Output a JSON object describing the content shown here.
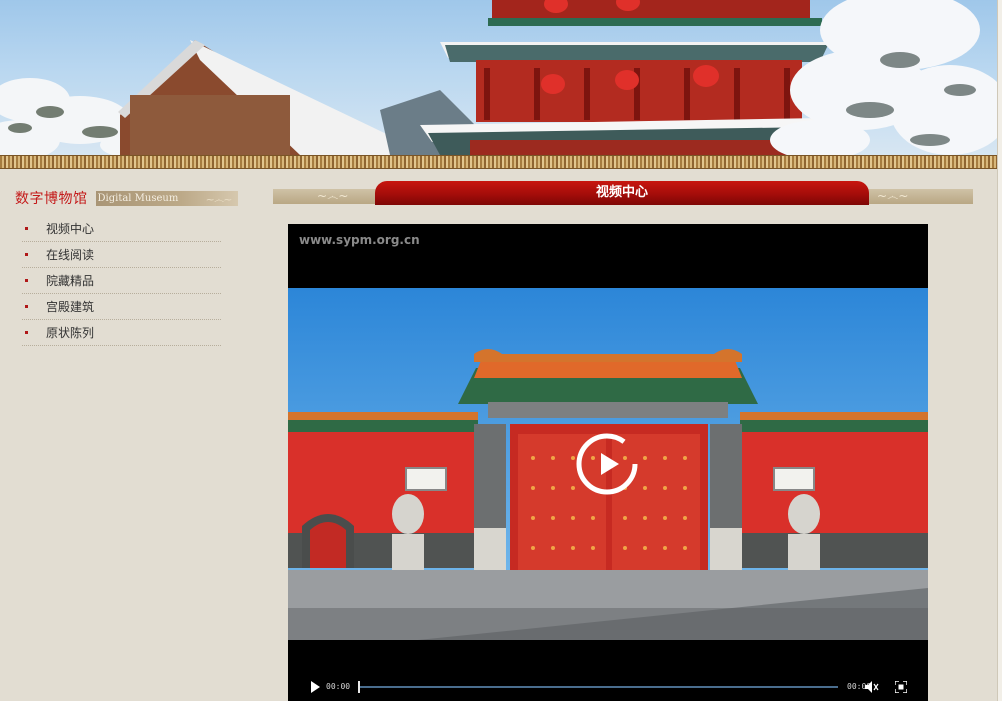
{
  "banner": {
    "alt": "沈阳故宫 雪景 banner"
  },
  "sidebar": {
    "title": "数字博物馆",
    "subtitle": "Digital Museum",
    "items": [
      {
        "label": "视频中心"
      },
      {
        "label": "在线阅读"
      },
      {
        "label": "院藏精品"
      },
      {
        "label": "宫殿建筑"
      },
      {
        "label": "原状陈列"
      }
    ]
  },
  "main": {
    "section_title": "视频中心",
    "player": {
      "watermark": "www.sypm.org.cn",
      "current_time": "00:00",
      "duration": "00:00",
      "progress": 0
    }
  },
  "colors": {
    "accent_red": "#b01818",
    "page_bg": "#e2ddd2",
    "player_bg": "#000000"
  },
  "icons": [
    "play-icon",
    "volume-icon",
    "fullscreen-icon",
    "bullet-icon"
  ]
}
